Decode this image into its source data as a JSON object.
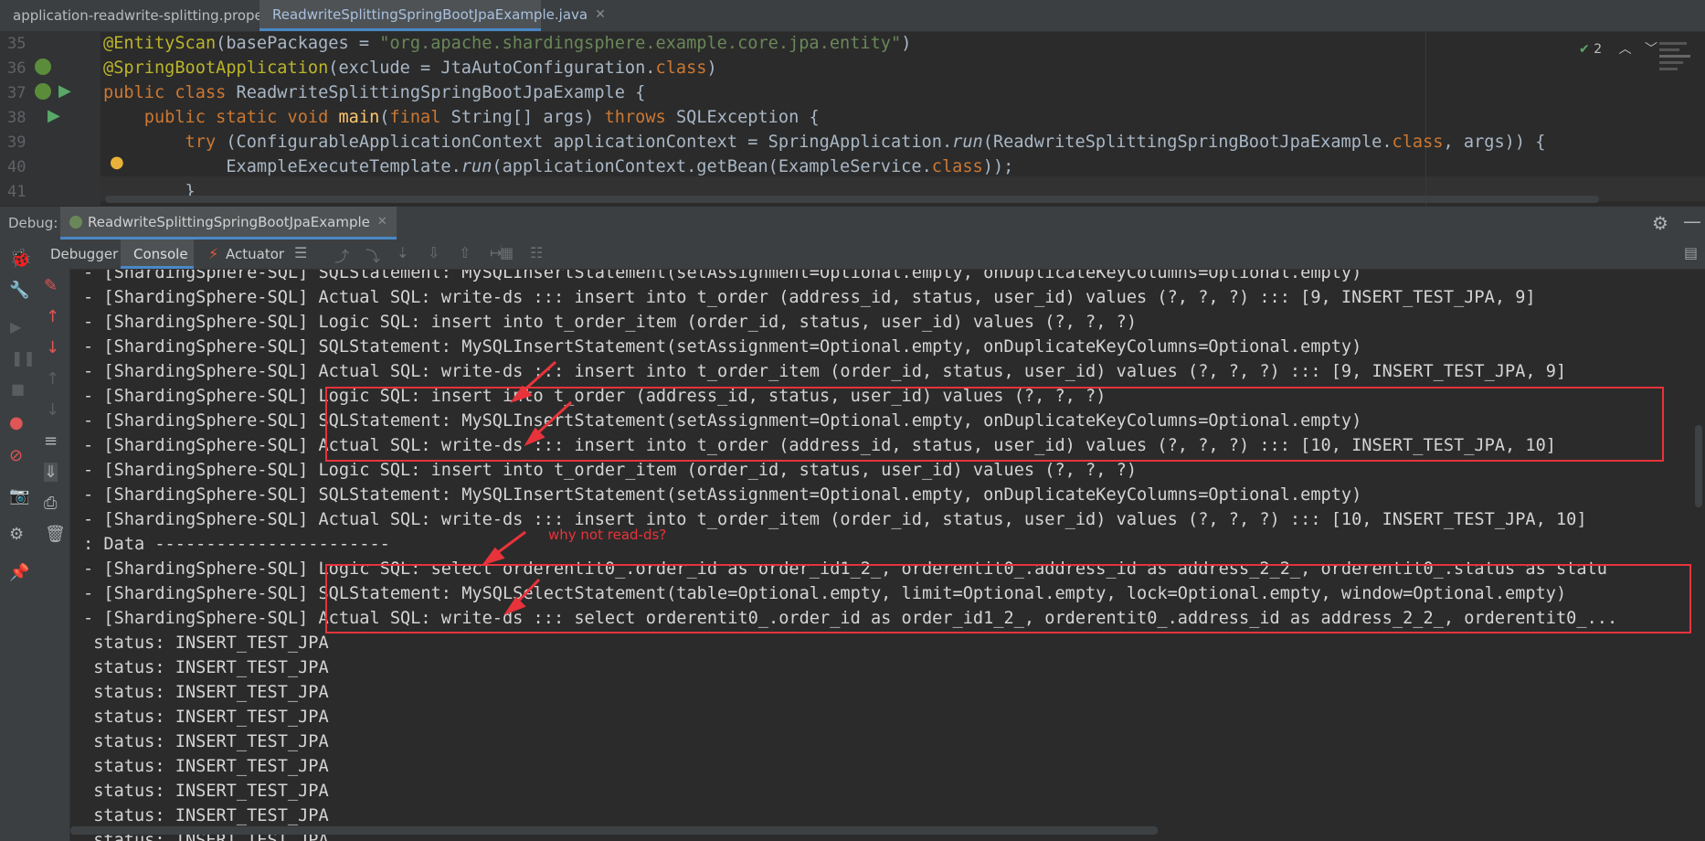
{
  "tabs": [
    {
      "label": "application-readwrite-splitting.properties",
      "active": false
    },
    {
      "label": "ReadwriteSplittingSpringBootJpaExample.java",
      "active": true
    }
  ],
  "editor": {
    "inspection_count": "2",
    "lines": [
      {
        "num": "35"
      },
      {
        "num": "36"
      },
      {
        "num": "37"
      },
      {
        "num": "38"
      },
      {
        "num": "39"
      },
      {
        "num": "40"
      },
      {
        "num": "41"
      }
    ],
    "code": {
      "l35_a": "@EntityScan",
      "l35_b": "(basePackages = ",
      "l35_c": "\"org.apache.shardingsphere.example.core.jpa.entity\"",
      "l35_d": ")",
      "l36_a": "@SpringBootApplication",
      "l36_b": "(exclude = JtaAutoConfiguration.",
      "l36_c": "class",
      "l36_d": ")",
      "l37_a": "public class ",
      "l37_b": "ReadwriteSplittingSpringBootJpaExample {",
      "l38_a": "    public static void ",
      "l38_b": "main",
      "l38_c": "(",
      "l38_d": "final ",
      "l38_e": "String[] args) ",
      "l38_f": "throws ",
      "l38_g": "SQLException {",
      "l39_a": "        try ",
      "l39_b": "(ConfigurableApplicationContext applicationContext = SpringApplication.",
      "l39_c": "run",
      "l39_d": "(ReadwriteSplittingSpringBootJpaExample.",
      "l39_e": "class",
      "l39_f": ", args)) {",
      "l40_a": "            ExampleExecuteTemplate.",
      "l40_b": "run",
      "l40_c": "(applicationContext.getBean(ExampleService.",
      "l40_d": "class",
      "l40_e": "));",
      "l41_a": "        }"
    }
  },
  "debug": {
    "label": "Debug:",
    "config_tab": "ReadwriteSplittingSpringBootJpaExample",
    "tabs": [
      "Debugger",
      "Console",
      "Actuator"
    ],
    "active_tab": "Console"
  },
  "console": {
    "lines": [
      "- [ShardingSphere-SQL] SQLStatement: MySQLInsertStatement(setAssignment=Optional.empty, onDuplicateKeyColumns=Optional.empty)",
      "- [ShardingSphere-SQL] Actual SQL: write-ds ::: insert into t_order (address_id, status, user_id) values (?, ?, ?) ::: [9, INSERT_TEST_JPA, 9]",
      "- [ShardingSphere-SQL] Logic SQL: insert into t_order_item (order_id, status, user_id) values (?, ?, ?)",
      "- [ShardingSphere-SQL] SQLStatement: MySQLInsertStatement(setAssignment=Optional.empty, onDuplicateKeyColumns=Optional.empty)",
      "- [ShardingSphere-SQL] Actual SQL: write-ds ::: insert into t_order_item (order_id, status, user_id) values (?, ?, ?) ::: [9, INSERT_TEST_JPA, 9]",
      "- [ShardingSphere-SQL] Logic SQL: insert into t_order (address_id, status, user_id) values (?, ?, ?)",
      "- [ShardingSphere-SQL] SQLStatement: MySQLInsertStatement(setAssignment=Optional.empty, onDuplicateKeyColumns=Optional.empty)",
      "- [ShardingSphere-SQL] Actual SQL: write-ds ::: insert into t_order (address_id, status, user_id) values (?, ?, ?) ::: [10, INSERT_TEST_JPA, 10]",
      "- [ShardingSphere-SQL] Logic SQL: insert into t_order_item (order_id, status, user_id) values (?, ?, ?)",
      "- [ShardingSphere-SQL] SQLStatement: MySQLInsertStatement(setAssignment=Optional.empty, onDuplicateKeyColumns=Optional.empty)",
      "- [ShardingSphere-SQL] Actual SQL: write-ds ::: insert into t_order_item (order_id, status, user_id) values (?, ?, ?) ::: [10, INSERT_TEST_JPA, 10]",
      ": Data -----------------------",
      "- [ShardingSphere-SQL] Logic SQL: select orderentit0_.order_id as order_id1_2_, orderentit0_.address_id as address_2_2_, orderentit0_.status as statu",
      "- [ShardingSphere-SQL] SQLStatement: MySQLSelectStatement(table=Optional.empty, limit=Optional.empty, lock=Optional.empty, window=Optional.empty)",
      "- [ShardingSphere-SQL] Actual SQL: write-ds ::: select orderentit0_.order_id as order_id1_2_, orderentit0_.address_id as address_2_2_, orderentit0_...",
      " status: INSERT_TEST_JPA",
      " status: INSERT_TEST_JPA",
      " status: INSERT_TEST_JPA",
      " status: INSERT_TEST_JPA",
      " status: INSERT_TEST_JPA",
      " status: INSERT_TEST_JPA",
      " status: INSERT_TEST_JPA",
      " status: INSERT_TEST_JPA",
      " status: INSERT_TEST_JPA"
    ],
    "annotation": "why not read-ds?"
  },
  "colors": {
    "highlight_box": "#e8333b",
    "keyword": "#cc7832",
    "annotation": "#bbb529",
    "string": "#6a8759"
  }
}
